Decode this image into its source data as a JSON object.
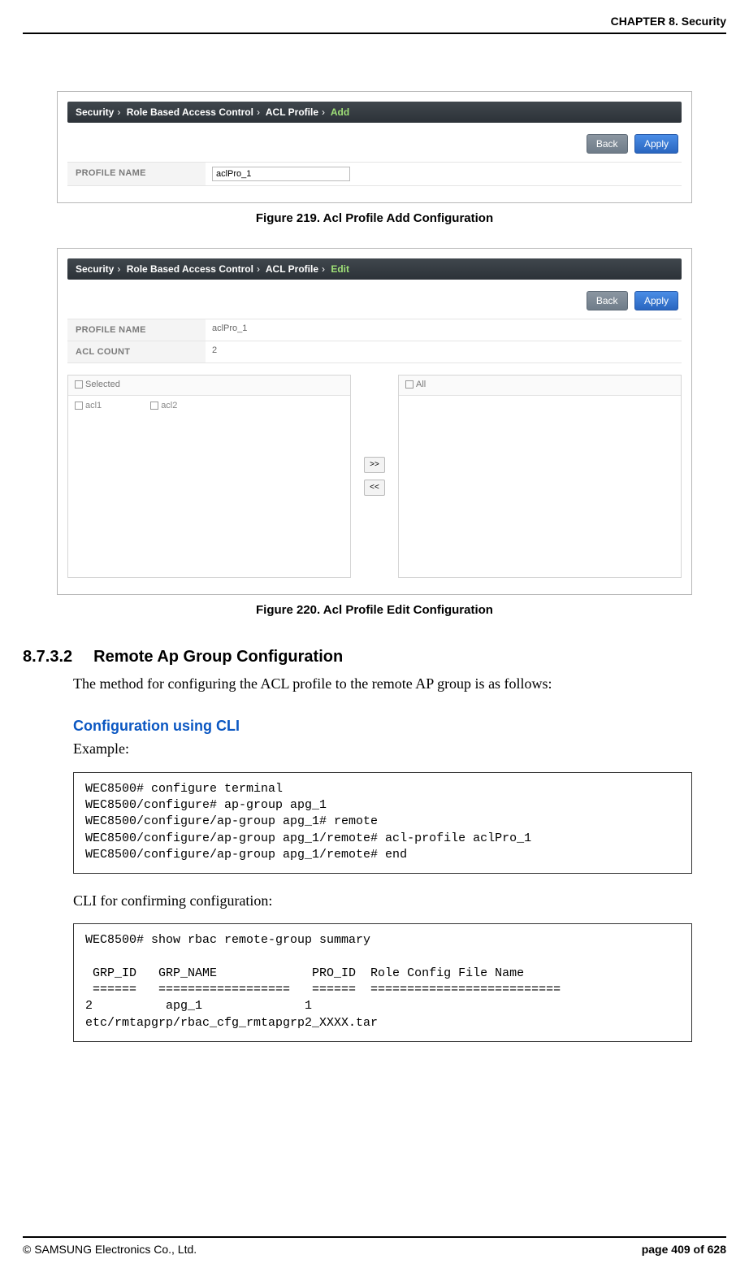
{
  "chapter_header": "CHAPTER 8. Security",
  "figure1": {
    "breadcrumb": [
      "Security",
      "Role Based Access Control",
      "ACL Profile"
    ],
    "breadcrumb_last": "Add",
    "btn_back": "Back",
    "btn_apply": "Apply",
    "label_profile_name": "PROFILE NAME",
    "value_profile_name": "aclPro_1",
    "caption": "Figure 219. Acl Profile Add Configuration"
  },
  "figure2": {
    "breadcrumb": [
      "Security",
      "Role Based Access Control",
      "ACL Profile"
    ],
    "breadcrumb_last": "Edit",
    "btn_back": "Back",
    "btn_apply": "Apply",
    "label_profile_name": "PROFILE NAME",
    "value_profile_name": "aclPro_1",
    "label_acl_count": "ACL COUNT",
    "value_acl_count": "2",
    "selected_header": "Selected",
    "all_header": "All",
    "acl1": "acl1",
    "acl2": "acl2",
    "mover_right": ">>",
    "mover_left": "<<",
    "caption": "Figure 220. Acl Profile Edit Configuration"
  },
  "section": {
    "number": "8.7.3.2",
    "title": "Remote Ap Group Configuration",
    "intro": "The method for configuring the ACL profile to the remote AP group is as follows:",
    "cli_heading": "Configuration using CLI",
    "example_label": "Example:",
    "code1": "WEC8500# configure terminal\nWEC8500/configure# ap-group apg_1\nWEC8500/configure/ap-group apg_1# remote\nWEC8500/configure/ap-group apg_1/remote# acl-profile aclPro_1\nWEC8500/configure/ap-group apg_1/remote# end",
    "cli_confirm": "CLI for confirming configuration:",
    "code2": "WEC8500# show rbac remote-group summary\n\n GRP_ID   GRP_NAME             PRO_ID  Role Config File Name\n ======   ==================   ======  ==========================\n2          apg_1              1\netc/rmtapgrp/rbac_cfg_rmtapgrp2_XXXX.tar"
  },
  "footer": {
    "copyright": "© SAMSUNG Electronics Co., Ltd.",
    "page": "page 409 of 628"
  }
}
